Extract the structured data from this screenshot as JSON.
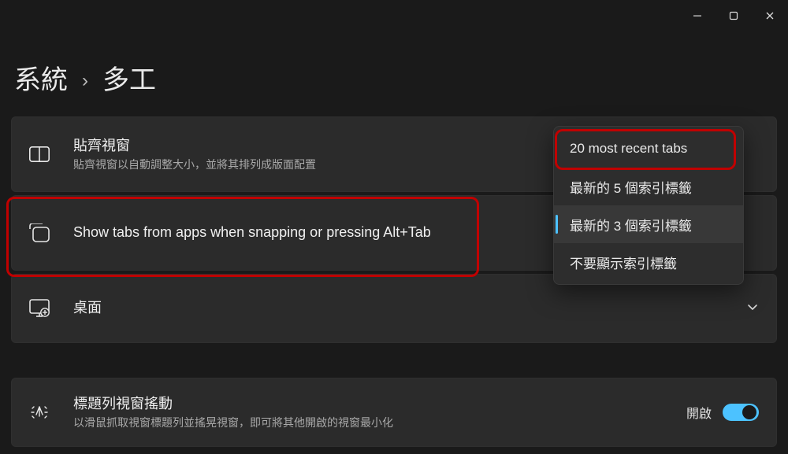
{
  "breadcrumb": {
    "root": "系統",
    "current": "多工"
  },
  "rows": {
    "snap": {
      "title": "貼齊視窗",
      "desc": "貼齊視窗以自動調整大小，並將其排列成版面配置"
    },
    "tabs": {
      "title": "Show tabs from apps when snapping or pressing Alt+Tab"
    },
    "desktops": {
      "title": "桌面"
    },
    "shake": {
      "title": "標題列視窗搖動",
      "desc": "以滑鼠抓取視窗標題列並搖晃視窗，即可將其他開啟的視窗最小化",
      "state_label": "開啟"
    }
  },
  "dropdown": {
    "options": [
      "20 most recent tabs",
      "最新的 5 個索引標籤",
      "最新的 3 個索引標籤",
      "不要顯示索引標籤"
    ],
    "selected_index": 2
  }
}
